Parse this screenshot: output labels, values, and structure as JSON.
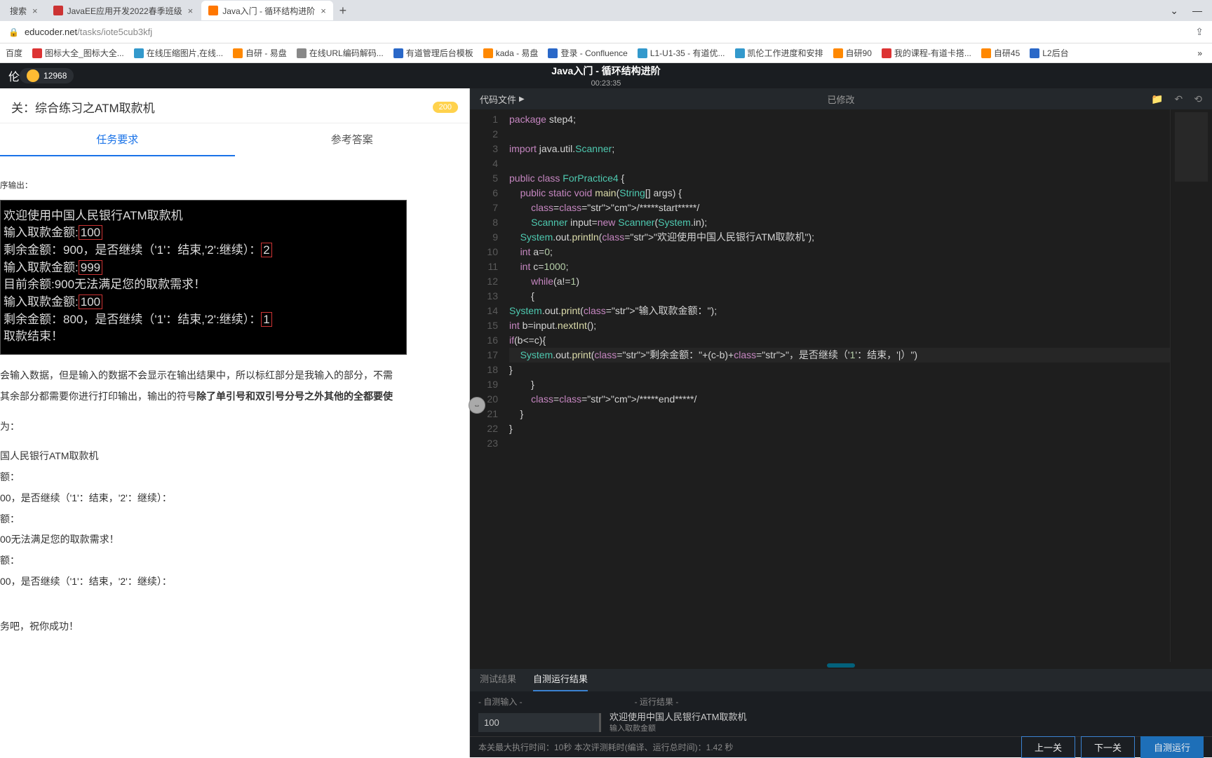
{
  "browser": {
    "tabs": [
      {
        "label": "搜索"
      },
      {
        "label": "JavaEE应用开发2022春季班级"
      },
      {
        "label": "Java入门 - 循环结构进阶"
      }
    ],
    "url_host": "educoder.net",
    "url_path": "/tasks/iote5cub3kfj"
  },
  "bookmarks": [
    "百度",
    "图标大全_图标大全...",
    "在线压缩图片,在线...",
    "自研 - 易盘",
    "在线URL编码解码...",
    "有道管理后台模板",
    "kada - 易盘",
    "登录 - Confluence",
    "L1-U1-35 - 有道优...",
    "凯伦工作进度和安排",
    "自研90",
    "我的课程-有道卡搭...",
    "自研45",
    "L2后台"
  ],
  "header": {
    "user_label": "伦",
    "coins": "12968",
    "title": "Java入门 - 循环结构进阶",
    "timer": "00:23:35"
  },
  "task": {
    "title_prefix": "关：综合练习之ATM取款机",
    "badge": "200",
    "tabs": {
      "req": "任务要求",
      "ans": "参考答案"
    },
    "section_output": "序输出：",
    "term_lines": [
      {
        "t": "欢迎使用中国人民银行ATM取款机"
      },
      {
        "t": "输入取款金额:",
        "boxed": "100"
      },
      {
        "t": "剩余金额：900，是否继续（'1'：结束,'2':继续）：",
        "boxed": "2"
      },
      {
        "t": "输入取款金额:",
        "boxed": "999"
      },
      {
        "t": "目前余额:900无法满足您的取款需求！"
      },
      {
        "t": "输入取款金额:",
        "boxed": "100"
      },
      {
        "t": "剩余金额：800，是否继续（'1'：结束,'2':继续）：",
        "boxed": "1"
      },
      {
        "t": "取款结束！"
      }
    ],
    "p1a": "会输入数据，但是输入的数据不会显示在输出结果中，所以标红部分是我输入的部分，不需",
    "p1b": "其余部分都需要你进行打印输出，输出的符号",
    "p1c": "除了单引号和双引号分号之外其他的全都要使",
    "p2": "为：",
    "p3": "国人民银行ATM取款机",
    "p4": "额：",
    "p5": "00，是否继续（'1'：结束，'2'：继续）：",
    "p6": "额：",
    "p7": "00无法满足您的取款需求！",
    "p8": "额：",
    "p9": "00，是否继续（'1'：结束，'2'：继续）：",
    "p10": "务吧，祝你成功！"
  },
  "editor": {
    "tab": "代码文件",
    "modified": "已修改",
    "lines": [
      "package step4;",
      "",
      "import java.util.Scanner;",
      "",
      "public class ForPractice4 {",
      "    public static void main(String[] args) {",
      "        /*****start*****/",
      "        Scanner input=new Scanner(System.in);",
      "    System.out.println(\"欢迎使用中国人民银行ATM取款机\");",
      "    int a=0;",
      "    int c=1000;",
      "        while(a!=1)",
      "        {",
      "System.out.print(\"输入取款金额：\");",
      "int b=input.nextInt();",
      "if(b<=c){",
      "    System.out.print(\"剩余金额：\"+(c-b)+\"，是否继续（'1'：结束，'|）\")",
      "}",
      "        }",
      "        /*****end*****/",
      "    }",
      "}",
      ""
    ]
  },
  "results": {
    "tab1": "测试结果",
    "tab2": "自测运行结果",
    "lbl_input": "- 自测输入 -",
    "lbl_output": "- 运行结果 -",
    "input_val": "100",
    "out_line1": "欢迎使用中国人民银行ATM取款机",
    "out_line2": "输入取款金额"
  },
  "footer": {
    "info": "本关最大执行时间：10秒    本次评测耗时(编译、运行总时间)：1.42 秒",
    "prev": "上一关",
    "next": "下一关",
    "run": "自测运行"
  }
}
